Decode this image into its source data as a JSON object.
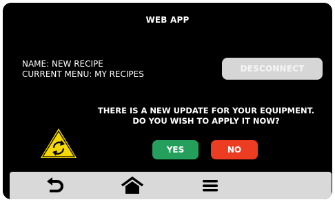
{
  "app": {
    "title": "WEB APP"
  },
  "recipe_info": {
    "name_line": "NAME: NEW RECIPE",
    "menu_line": "CURRENT MENU: MY RECIPES"
  },
  "disconnect_label": "DESCONNECT",
  "dialog": {
    "line1": "THERE IS A NEW UPDATE FOR YOUR EQUIPMENT.",
    "line2": "DO YOU WISH TO APPLY IT NOW?",
    "yes_label": "YES",
    "no_label": "NO",
    "icon": "update-warning-icon"
  },
  "navbar": {
    "items": [
      {
        "icon": "back-icon"
      },
      {
        "icon": "home-icon"
      },
      {
        "icon": "menu-icon"
      }
    ]
  },
  "colors": {
    "background": "#000000",
    "disconnect_button": "#d6d6d6",
    "yes_button": "#25a05c",
    "no_button": "#ec3c22",
    "warning_fill": "#f5d800",
    "navbar": "#d9d9d9"
  }
}
